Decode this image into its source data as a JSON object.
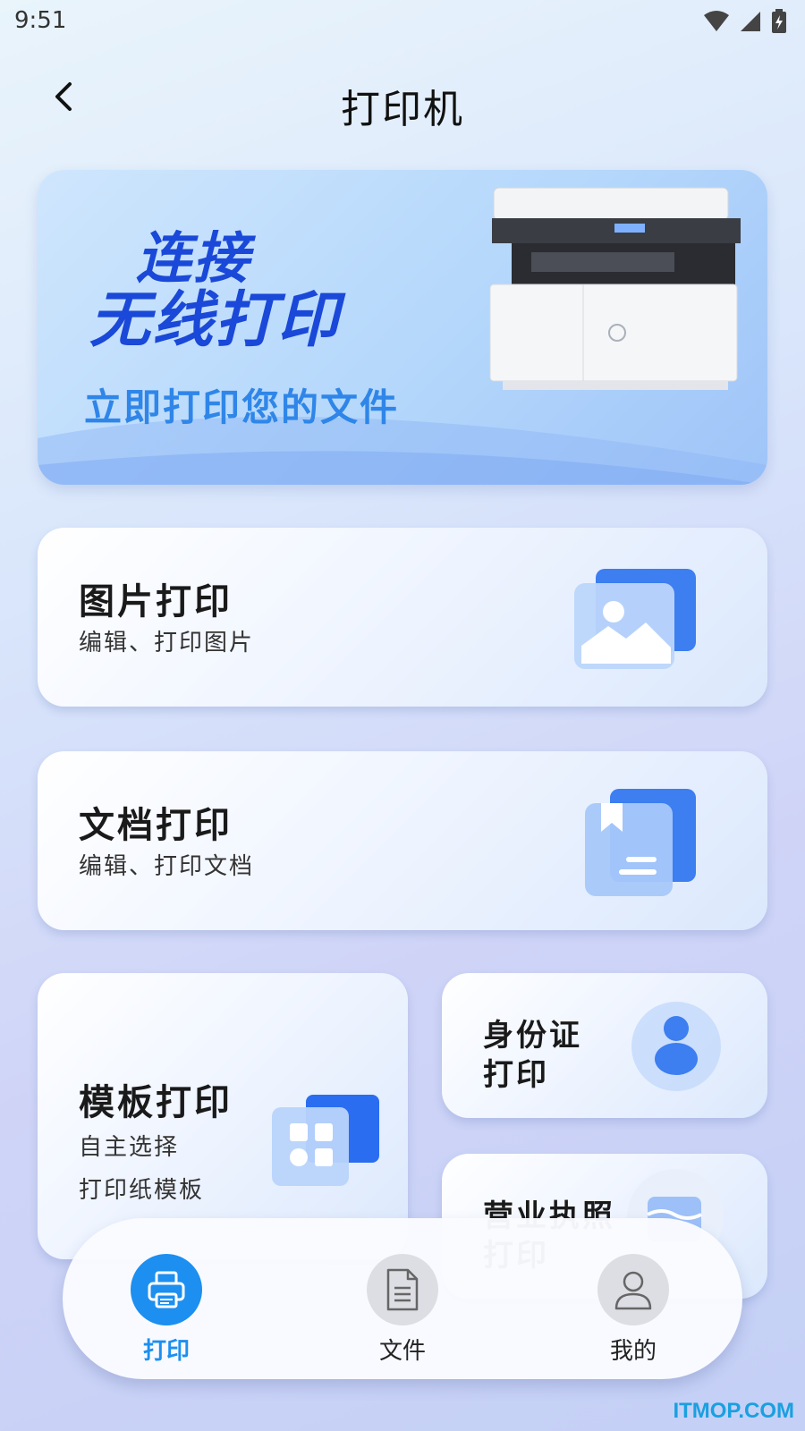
{
  "status": {
    "time": "9:51"
  },
  "header": {
    "title": "打印机"
  },
  "banner": {
    "slogan_line1": "连接",
    "slogan_line2": "无线打印",
    "subtitle": "立即打印您的文件"
  },
  "cards": {
    "photo": {
      "title": "图片打印",
      "subtitle": "编辑、打印图片"
    },
    "document": {
      "title": "文档打印",
      "subtitle": "编辑、打印文档"
    },
    "template": {
      "title": "模板打印",
      "subtitle_line1": "自主选择",
      "subtitle_line2": "打印纸模板"
    },
    "id_card": {
      "title_line1": "身份证",
      "title_line2": "打印"
    },
    "business_license": {
      "title_line1": "营业执照",
      "title_line2": "打印"
    }
  },
  "nav": {
    "items": [
      {
        "label": "打印",
        "icon": "printer-icon",
        "active": true
      },
      {
        "label": "文件",
        "icon": "file-icon",
        "active": false
      },
      {
        "label": "我的",
        "icon": "user-icon",
        "active": false
      }
    ]
  },
  "watermark": "ITMOP.COM",
  "colors": {
    "accent": "#1c8ff0",
    "slogan": "#1a48d8",
    "subtitle": "#2f86e8"
  }
}
